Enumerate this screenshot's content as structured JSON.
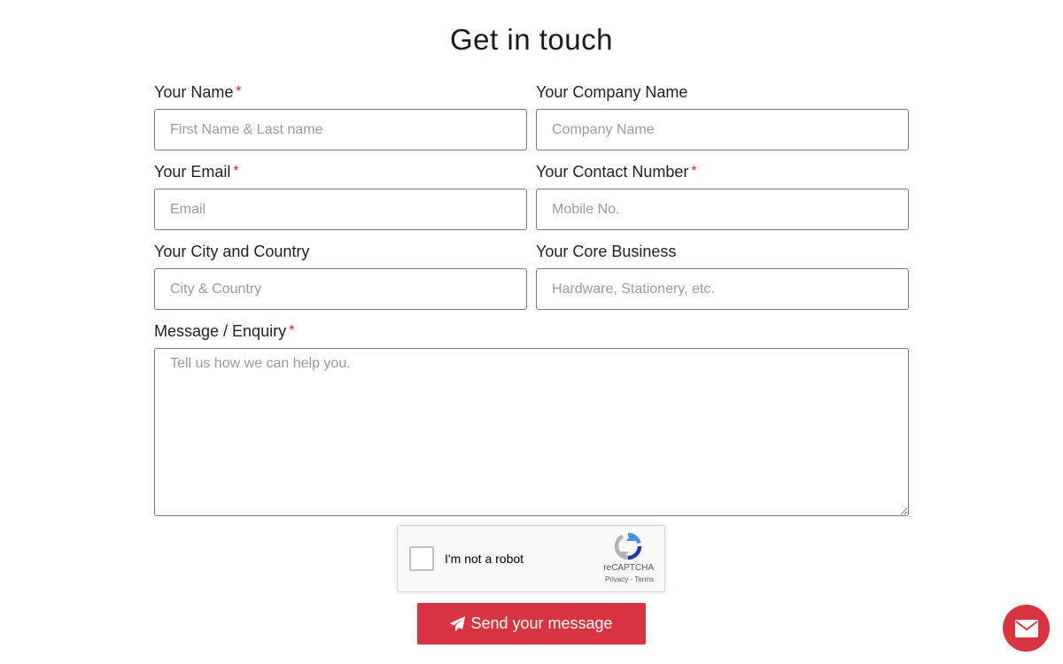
{
  "page": {
    "title": "Get in touch"
  },
  "form": {
    "name": {
      "label": "Your Name",
      "required_marker": "*",
      "placeholder": "First Name & Last name",
      "value": ""
    },
    "company": {
      "label": "Your Company Name",
      "placeholder": "Company Name",
      "value": ""
    },
    "email": {
      "label": "Your Email",
      "required_marker": "*",
      "placeholder": "Email",
      "value": ""
    },
    "contact": {
      "label": "Your Contact Number",
      "required_marker": "*",
      "placeholder": "Mobile No.",
      "value": ""
    },
    "city": {
      "label": "Your City and Country",
      "placeholder": "City & Country",
      "value": ""
    },
    "business": {
      "label": "Your Core Business",
      "placeholder": "Hardware, Stationery, etc.",
      "value": ""
    },
    "message": {
      "label": "Message / Enquiry",
      "required_marker": "*",
      "placeholder": "Tell us how we can help you.",
      "value": ""
    }
  },
  "captcha": {
    "label": "I'm not a robot",
    "brand": "reCAPTCHA",
    "privacy": "Privacy",
    "separator": " - ",
    "terms": "Terms",
    "checked": false
  },
  "actions": {
    "send_label": "Send your message",
    "send_icon": "paper-plane-icon",
    "fab_icon": "envelope-icon"
  },
  "colors": {
    "accent": "#d83340",
    "required": "#e02020",
    "input_border": "#777777"
  }
}
